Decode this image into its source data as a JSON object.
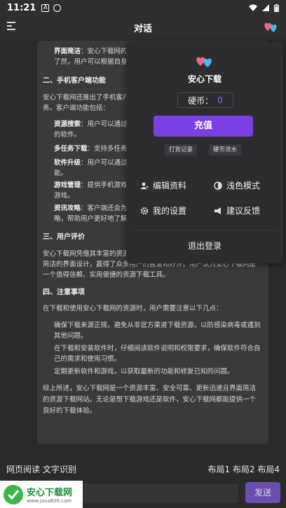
{
  "statusbar": {
    "time": "11:21",
    "icon_a": "A"
  },
  "header": {
    "title": "对话",
    "menu_icon": "hamburger-icon",
    "avatar_icon": "hearts-icon"
  },
  "article": {
    "line1_bold": "界面简洁",
    "line1_rest": "：安心下载网的界面设计",
    "line2": "了然，用户可以根据自身需",
    "h2": "二、手机客户端功能",
    "p2a": "安心下载网还推出了手机客户端",
    "p2b": "务。客户端功能包括：",
    "f1_bold": "资源搜索",
    "f1_rest": "：用户可以通过手机",
    "f1b": "的软件。",
    "f2_bold": "多任务下载",
    "f2_rest": "：支持多任务同时",
    "f3_bold": "软件升级",
    "f3_rest": "：用户可以通过手机",
    "f3b": "能。",
    "f4_bold": "游戏管理",
    "f4_rest": "：提供手机游戏的下",
    "f4b": "游戏。",
    "f5_bold": "资讯攻略",
    "f5_rest": "：客户端还会为用户",
    "f5b": "略，帮助用户更好地了解",
    "h3": "三、用户评价",
    "p3a": "安心下载网凭借其丰富的资源",
    "p3b": "简洁的界面设计，赢得了众多用户的喜爱和好评。用户认为安心下载网是",
    "p3c": "一个值得信赖、实用便捷的资源下载工具。",
    "h4": "四、注意事项",
    "p4": "在下载和使用安心下载网的资源时，用户需要注意以下几点：",
    "n1a": "确保下载来源正规，避免从非官方渠道下载资源，以防感染病毒或遇到",
    "n1b": "其他问题。",
    "n2a": "在下载和安装软件时，仔细阅读软件说明和权限要求，确保软件符合自",
    "n2b": "己的需求和使用习惯。",
    "n3": "定期更新软件和游戏，以获取最新的功能和修复已知的问题。",
    "p5a": "综上所述，安心下载网是一个资源丰富、安全可靠、更新迅速且界面简洁",
    "p5b": "的资源下载网站。无论是想下载游戏还是软件，安心下载网都能提供一个",
    "p5c": "良好的下载体验。"
  },
  "popup": {
    "username": "安心下载",
    "coins_label": "硬币：",
    "coins_value": "0",
    "recharge": "充值",
    "reward_log": "打赏记录",
    "coin_flow": "硬币流水",
    "edit_profile": "编辑资料",
    "light_mode": "浅色模式",
    "my_settings": "我的设置",
    "feedback": "建议反馈",
    "logout": "退出登录"
  },
  "bottom": {
    "left": "网页阅读 文字识别",
    "right": "布局1 布局2 布局4",
    "send": "发送"
  },
  "brand": {
    "name": "安心下载网",
    "url": "www.java800.com"
  },
  "colors": {
    "accent": "#7b3fe4",
    "coins": "#7a6cff",
    "background": "#2b2b2d"
  }
}
